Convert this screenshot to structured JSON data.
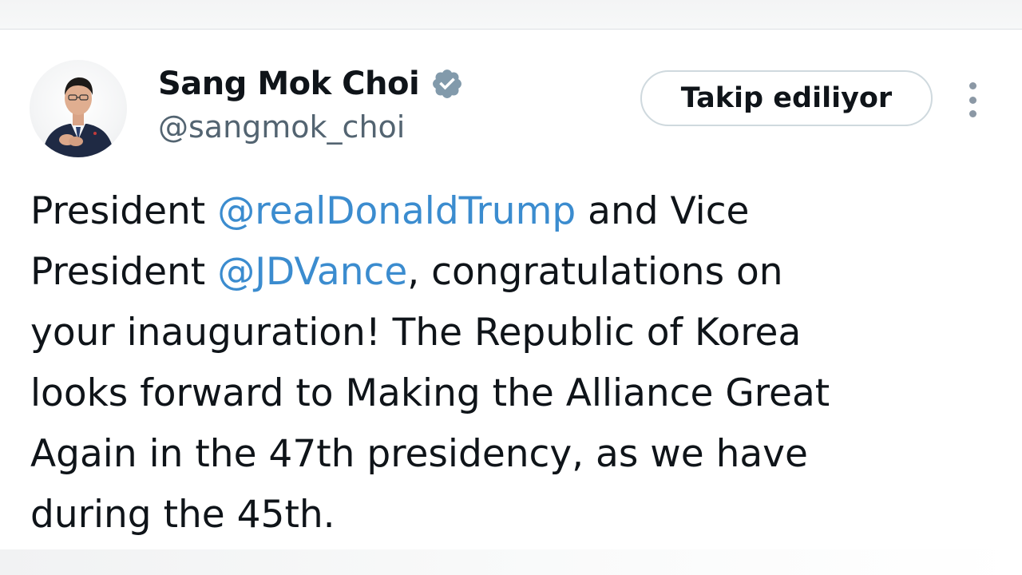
{
  "tweet": {
    "author": {
      "display_name": "Sang Mok Choi",
      "handle": "@sangmok_choi",
      "verified": true,
      "verified_icon": "verified-badge-icon"
    },
    "follow_button_label": "Takip ediliyor",
    "more_icon": "more-options-icon",
    "body": {
      "line1": {
        "a": "President ",
        "mention": "@realDonaldTrump",
        "b": " and Vice"
      },
      "line2": {
        "a": "President ",
        "mention": "@JDVance",
        "b": ", congratulations on"
      },
      "line3": "your inauguration! The Republic of Korea",
      "line4": "looks forward to Making the Alliance Great",
      "line5": "Again in the 47th presidency, as we have",
      "line6": "during the 45th."
    }
  },
  "colors": {
    "mention": "#3b8ccf",
    "text": "#0f1419",
    "secondary_text": "#536471",
    "verified_badge": "#829aab",
    "button_border": "#cfd9de"
  }
}
